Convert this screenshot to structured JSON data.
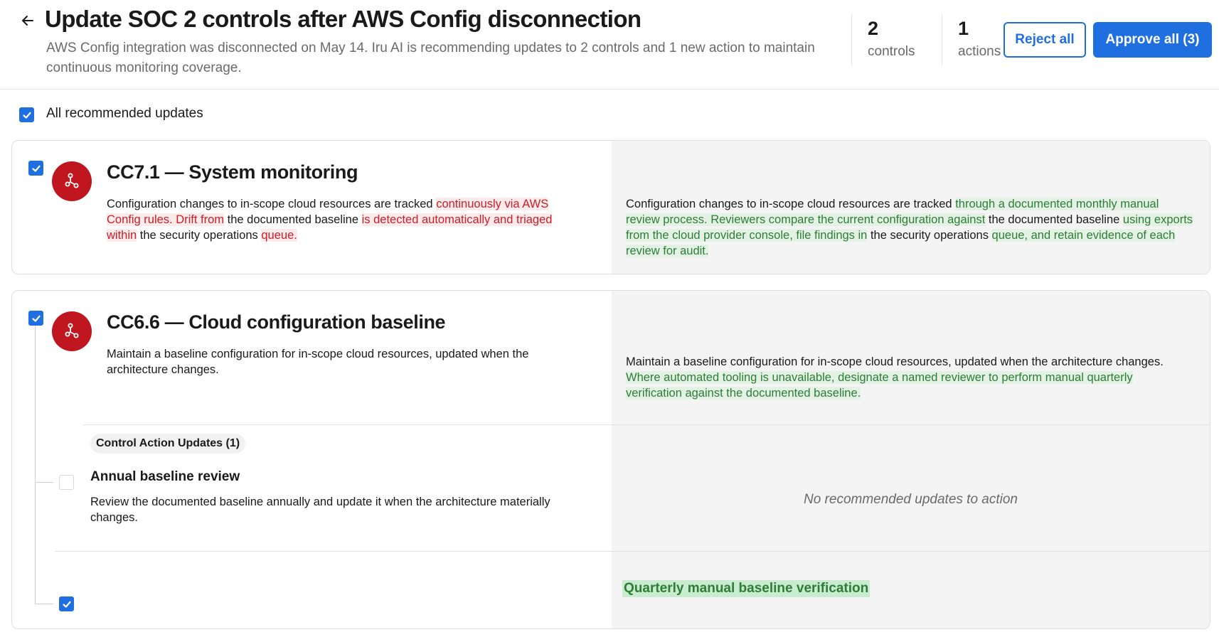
{
  "header": {
    "title": "Update SOC 2 controls after AWS Config disconnection",
    "subtitle": "AWS Config integration was disconnected on May 14. Iru AI is recommending updates to 2 controls and 1 new action to maintain continuous monitoring coverage.",
    "back_icon": "arrow-left-icon",
    "stats": [
      {
        "value": "2",
        "label": "controls"
      },
      {
        "value": "1",
        "label": "actions"
      }
    ],
    "reject_label": "Reject all",
    "approve_label": "Approve all (3)"
  },
  "select_all": {
    "label": "All recommended updates",
    "checked": true
  },
  "colors": {
    "accent": "#1f6fe0",
    "control_icon_bg": "#c0161f",
    "deletion_text": "#c8202a",
    "deletion_bg": "#fdeaea",
    "insertion_text": "#2e7d36",
    "insertion_bg": "#e3f2e5"
  },
  "controls": [
    {
      "id": "CC7.1",
      "title": "CC7.1 — System monitoring",
      "icon": "integration-nodes-icon",
      "checked": true,
      "current": [
        {
          "t": "Configuration changes to in-scope cloud resources are tracked ",
          "k": "same"
        },
        {
          "t": "continuously via AWS Config rules. Drift from",
          "k": "del"
        },
        {
          "t": " the documented baseline ",
          "k": "same"
        },
        {
          "t": "is detected automatically and triaged within",
          "k": "del"
        },
        {
          "t": " the security operations ",
          "k": "same"
        },
        {
          "t": "queue.",
          "k": "del"
        }
      ],
      "proposed": [
        {
          "t": "Configuration changes to in-scope cloud resources are tracked ",
          "k": "same"
        },
        {
          "t": "through a documented monthly manual review process. Reviewers compare the current configuration against",
          "k": "ins"
        },
        {
          "t": " the documented baseline ",
          "k": "same"
        },
        {
          "t": "using exports from the cloud provider console, file findings in",
          "k": "ins"
        },
        {
          "t": " the security operations ",
          "k": "same"
        },
        {
          "t": "queue, and retain evidence of each review for audit.",
          "k": "ins"
        }
      ]
    },
    {
      "id": "CC6.6",
      "title": "CC6.6 — Cloud configuration baseline",
      "icon": "integration-nodes-icon",
      "checked": true,
      "current": [
        {
          "t": "Maintain a baseline configuration for in-scope cloud resources, updated when the architecture changes.",
          "k": "same"
        }
      ],
      "proposed": [
        {
          "t": "Maintain a baseline configuration for in-scope cloud resources, updated when the architecture changes. ",
          "k": "same"
        },
        {
          "t": "Where automated tooling is unavailable, designate a named reviewer to perform manual quarterly verification against the documented baseline.",
          "k": "ins"
        }
      ],
      "action_updates": {
        "badge": "Control Action Updates (1)",
        "existing": {
          "title": "Annual baseline review",
          "description": "Review the documented baseline annually and update it when the architecture materially changes.",
          "checked": false,
          "right_note": "No recommended updates to action"
        },
        "new_action": {
          "title": "Quarterly manual baseline verification",
          "checked": true
        }
      }
    }
  ]
}
